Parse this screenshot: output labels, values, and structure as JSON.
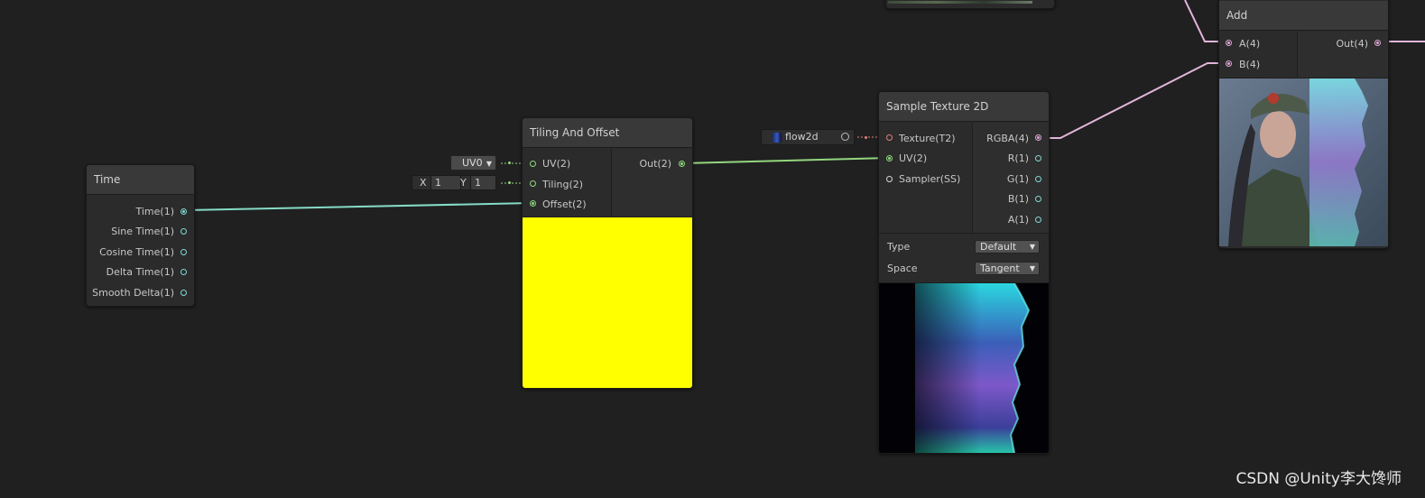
{
  "colors": {
    "background": "#202020",
    "wire_float": "#86dcc6",
    "wire_vec2": "#94d67f",
    "wire_vec4": "#e3b5dc",
    "preview_yellow": "#ffff00"
  },
  "time_node": {
    "title": "Time",
    "outputs": [
      "Time(1)",
      "Sine Time(1)",
      "Cosine Time(1)",
      "Delta Time(1)",
      "Smooth Delta(1)"
    ]
  },
  "tiling_node": {
    "title": "Tiling And Offset",
    "inputs": [
      "UV(2)",
      "Tiling(2)",
      "Offset(2)"
    ],
    "outputs": [
      "Out(2)"
    ],
    "uv_dropdown": "UV0",
    "tiling_x_label": "X",
    "tiling_x_value": "1",
    "tiling_y_label": "Y",
    "tiling_y_value": "1"
  },
  "sample_node": {
    "title": "Sample Texture 2D",
    "inputs": [
      "Texture(T2)",
      "UV(2)",
      "Sampler(SS)"
    ],
    "outputs": [
      "RGBA(4)",
      "R(1)",
      "G(1)",
      "B(1)",
      "A(1)"
    ],
    "texture_field": "flow2d",
    "type_label": "Type",
    "type_value": "Default",
    "space_label": "Space",
    "space_value": "Tangent"
  },
  "add_node": {
    "title": "Add",
    "inputs": [
      "A(4)",
      "B(4)"
    ],
    "outputs": [
      "Out(4)"
    ]
  },
  "watermark": "CSDN @Unity李大馋师"
}
